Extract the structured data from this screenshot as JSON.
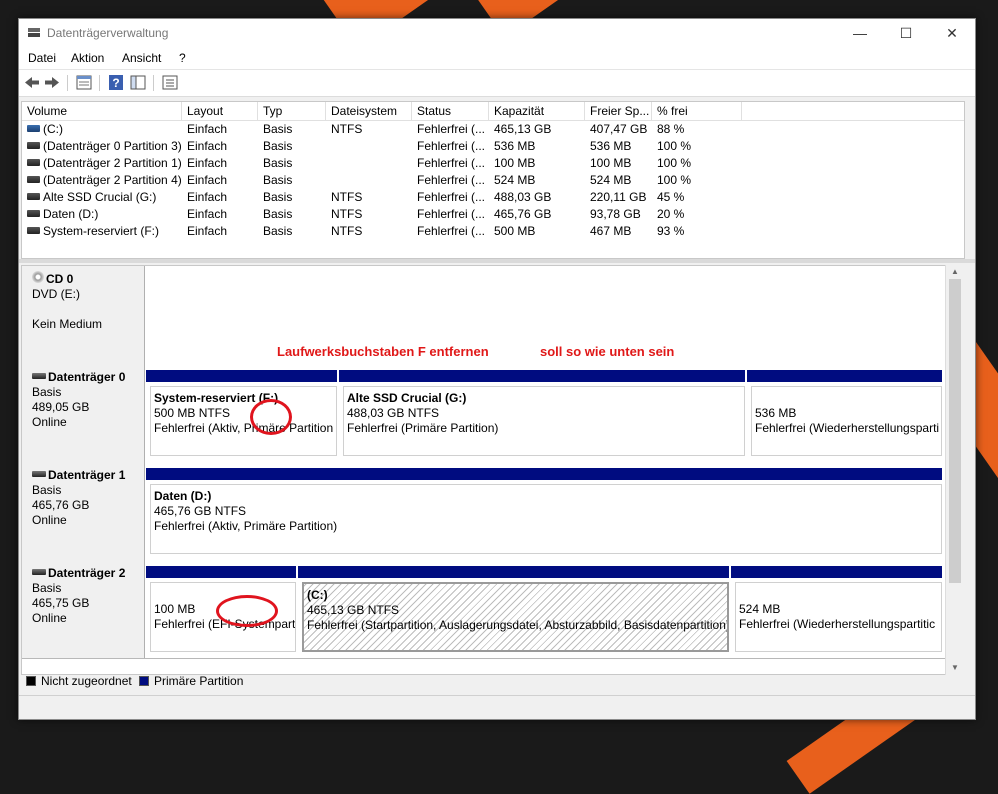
{
  "window": {
    "title": "Datenträgerverwaltung",
    "minimize": "—",
    "maximize": "☐",
    "close": "✕"
  },
  "menu": [
    "Datei",
    "Aktion",
    "Ansicht",
    "?"
  ],
  "toolbar": {
    "buttons": [
      "back-icon",
      "forward-icon",
      "properties-icon",
      "help-icon",
      "view-icon",
      "settings-icon"
    ]
  },
  "volume_list": {
    "columns": [
      "Volume",
      "Layout",
      "Typ",
      "Dateisystem",
      "Status",
      "Kapazität",
      "Freier Sp...",
      "% frei"
    ],
    "rows": [
      [
        "(C:)",
        "Einfach",
        "Basis",
        "NTFS",
        "Fehlerfrei (...",
        "465,13 GB",
        "407,47 GB",
        "88 %"
      ],
      [
        "(Datenträger 0 Partition 3)",
        "Einfach",
        "Basis",
        "",
        "Fehlerfrei (...",
        "536 MB",
        "536 MB",
        "100 %"
      ],
      [
        "(Datenträger 2 Partition 1)",
        "Einfach",
        "Basis",
        "",
        "Fehlerfrei (...",
        "100 MB",
        "100 MB",
        "100 %"
      ],
      [
        "(Datenträger 2 Partition 4)",
        "Einfach",
        "Basis",
        "",
        "Fehlerfrei (...",
        "524 MB",
        "524 MB",
        "100 %"
      ],
      [
        "Alte SSD Crucial (G:)",
        "Einfach",
        "Basis",
        "NTFS",
        "Fehlerfrei (...",
        "488,03 GB",
        "220,11 GB",
        "45 %"
      ],
      [
        "Daten (D:)",
        "Einfach",
        "Basis",
        "NTFS",
        "Fehlerfrei (...",
        "465,76 GB",
        "93,78 GB",
        "20 %"
      ],
      [
        "System-reserviert (F:)",
        "Einfach",
        "Basis",
        "NTFS",
        "Fehlerfrei (...",
        "500 MB",
        "467 MB",
        "93 %"
      ]
    ]
  },
  "disks": {
    "cd0": {
      "name": "CD 0",
      "line1": "DVD (E:)",
      "line2": "Kein Medium"
    },
    "d0": {
      "name": "Datenträger 0",
      "type": "Basis",
      "size": "489,05 GB",
      "status": "Online",
      "parts": [
        {
          "title": "System-reserviert",
          "letter": "(F:)",
          "size": "500 MB NTFS",
          "status": "Fehlerfrei (Aktiv, Primäre Partition"
        },
        {
          "title": "Alte SSD Crucial  (G:)",
          "size": "488,03 GB NTFS",
          "status": "Fehlerfrei (Primäre Partition)"
        },
        {
          "size": "536 MB",
          "status": "Fehlerfrei (Wiederherstellungsparti"
        }
      ]
    },
    "d1": {
      "name": "Datenträger 1",
      "type": "Basis",
      "size": "465,76 GB",
      "status": "Online",
      "parts": [
        {
          "title": "Daten  (D:)",
          "size": "465,76 GB NTFS",
          "status": "Fehlerfrei (Aktiv, Primäre Partition)"
        }
      ]
    },
    "d2": {
      "name": "Datenträger 2",
      "type": "Basis",
      "size": "465,75 GB",
      "status": "Online",
      "parts": [
        {
          "size": "100 MB",
          "status": "Fehlerfrei (EFI-Systempart"
        },
        {
          "title": "(C:)",
          "size": "465,13 GB NTFS",
          "status": "Fehlerfrei (Startpartition, Auslagerungsdatei, Absturzabbild, Basisdatenpartition)"
        },
        {
          "size": "524 MB",
          "status": "Fehlerfrei (Wiederherstellungspartitic"
        }
      ]
    }
  },
  "annotations": {
    "left": "Laufwerksbuchstaben  F  entfernen",
    "right": "soll so wie unten sein"
  },
  "legend": {
    "unallocated": "Nicht zugeordnet",
    "primary": "Primäre Partition"
  },
  "colors": {
    "primary_partition": "#000c80",
    "annotation": "#e01818"
  }
}
